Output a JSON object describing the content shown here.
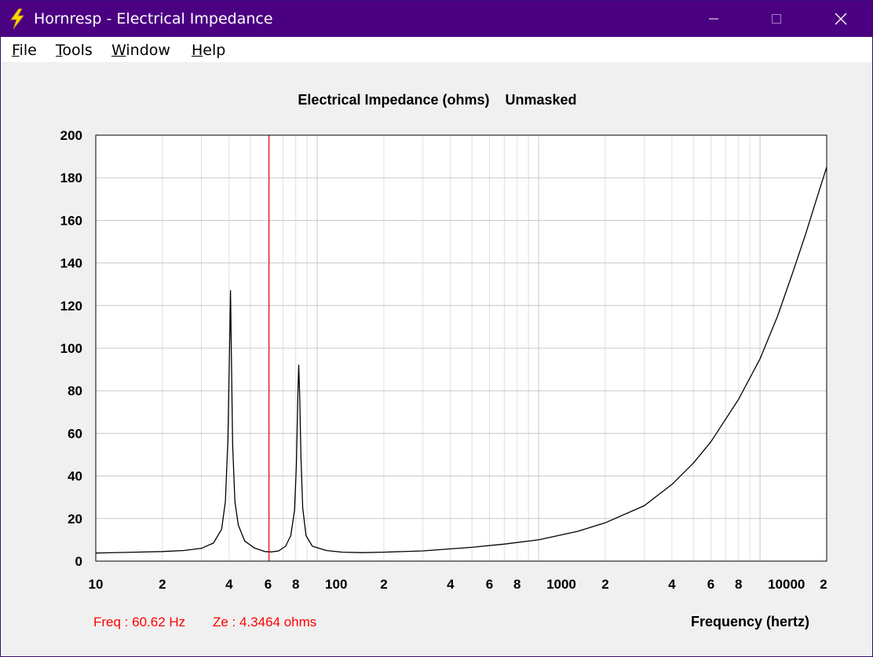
{
  "window": {
    "title": "Hornresp - Electrical Impedance",
    "icon": "lightning-icon",
    "controls": [
      "minimize-icon",
      "maximize-icon",
      "close-icon"
    ]
  },
  "menu": {
    "items": [
      {
        "label": "File",
        "accel": "F",
        "rest": "ile"
      },
      {
        "label": "Tools",
        "accel": "T",
        "rest": "ools"
      },
      {
        "label": "Window",
        "accel": "W",
        "rest": "indow"
      },
      {
        "label": "Help",
        "accel": "H",
        "rest": "elp"
      }
    ]
  },
  "colors": {
    "titlebar": "#4b0082",
    "curve": "#000000",
    "cursor": "#ff0000",
    "grid": "#c8c8c8",
    "grid_minor": "#e0e0e0"
  },
  "chart_data": {
    "type": "line",
    "title": "Electrical Impedance (ohms)",
    "mask_state": "Unmasked",
    "xlabel": "Frequency (hertz)",
    "ylabel": "",
    "x_scale": "log",
    "xlim": [
      10,
      20000
    ],
    "ylim": [
      0,
      200
    ],
    "y_ticks": [
      0,
      20,
      40,
      60,
      80,
      100,
      120,
      140,
      160,
      180,
      200
    ],
    "x_tick_labels": [
      {
        "value": 10,
        "label": "10"
      },
      {
        "value": 20,
        "label": "2"
      },
      {
        "value": 40,
        "label": "4"
      },
      {
        "value": 60,
        "label": "6"
      },
      {
        "value": 80,
        "label": "8"
      },
      {
        "value": 100,
        "label": "100"
      },
      {
        "value": 200,
        "label": "2"
      },
      {
        "value": 400,
        "label": "4"
      },
      {
        "value": 600,
        "label": "6"
      },
      {
        "value": 800,
        "label": "8"
      },
      {
        "value": 1000,
        "label": "1000"
      },
      {
        "value": 2000,
        "label": "2"
      },
      {
        "value": 4000,
        "label": "4"
      },
      {
        "value": 6000,
        "label": "6"
      },
      {
        "value": 8000,
        "label": "8"
      },
      {
        "value": 10000,
        "label": "10000"
      },
      {
        "value": 20000,
        "label": "2"
      }
    ],
    "grid": true,
    "series": [
      {
        "x": [
          10,
          15,
          20,
          25,
          30,
          34,
          37,
          38.5,
          39.5,
          40.2,
          40.6,
          41,
          41.5,
          42.5,
          44,
          47,
          52,
          58,
          62,
          67,
          72,
          76,
          79,
          80.5,
          81.8,
          82.5,
          83.3,
          84.5,
          86,
          89,
          95,
          110,
          130,
          160,
          200,
          300,
          500,
          700,
          1000,
          1500,
          2000,
          3000,
          4000,
          5000,
          6000,
          8000,
          10000,
          12000,
          14000,
          16000,
          18000,
          20000
        ],
        "y": [
          3.8,
          4.2,
          4.5,
          5,
          6,
          8.5,
          15,
          28,
          57,
          100,
          127,
          95,
          55,
          28,
          17,
          9.5,
          6.2,
          4.5,
          4.3,
          4.8,
          7,
          12,
          24,
          45,
          78,
          92,
          78,
          48,
          25,
          12,
          7,
          5,
          4.2,
          4,
          4.2,
          4.8,
          6.5,
          8,
          10,
          14,
          18,
          26,
          36,
          46,
          56,
          76,
          95,
          115,
          135,
          153,
          170,
          185
        ]
      }
    ],
    "cursor": {
      "freq": 60.62,
      "impedance": 4.3464
    }
  },
  "readout": {
    "freq_text": "Freq : 60.62 Hz",
    "ze_text": "Ze : 4.3464 ohms"
  }
}
